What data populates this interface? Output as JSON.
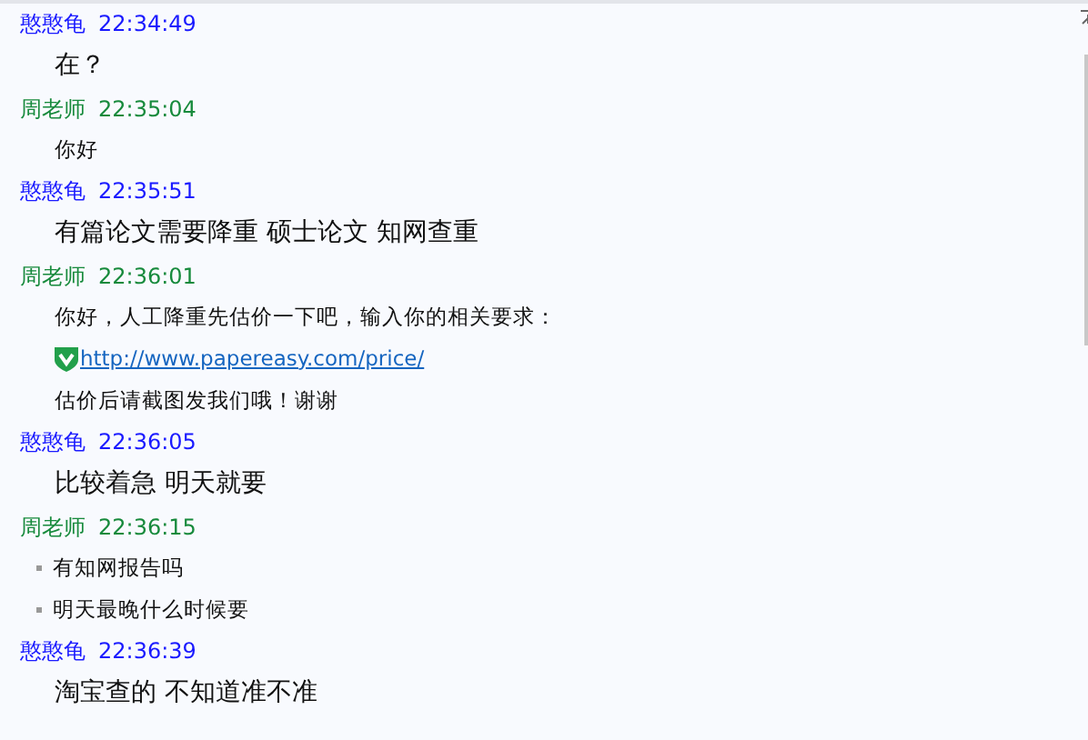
{
  "messages": [
    {
      "sender": "憨憨龟",
      "outgoing": true,
      "time": "22:34:49",
      "lines": [
        {
          "kind": "text",
          "text": "在？"
        }
      ]
    },
    {
      "sender": "周老师",
      "outgoing": false,
      "time": "22:35:04",
      "lines": [
        {
          "kind": "text",
          "text": "你好"
        }
      ]
    },
    {
      "sender": "憨憨龟",
      "outgoing": true,
      "time": "22:35:51",
      "lines": [
        {
          "kind": "text",
          "text": "有篇论文需要降重 硕士论文 知网查重"
        }
      ]
    },
    {
      "sender": "周老师",
      "outgoing": false,
      "time": "22:36:01",
      "lines": [
        {
          "kind": "text",
          "text": "你好，人工降重先估价一下吧，输入你的相关要求："
        },
        {
          "kind": "link",
          "text": "http://www.papereasy.com/price/"
        },
        {
          "kind": "text",
          "text": "估价后请截图发我们哦！谢谢"
        }
      ]
    },
    {
      "sender": "憨憨龟",
      "outgoing": true,
      "time": "22:36:05",
      "lines": [
        {
          "kind": "text",
          "text": "比较着急 明天就要"
        }
      ]
    },
    {
      "sender": "周老师",
      "outgoing": false,
      "time": "22:36:15",
      "lines": [
        {
          "kind": "bullet",
          "text": "有知网报告吗"
        },
        {
          "kind": "bullet",
          "text": "明天最晚什么时候要"
        }
      ]
    },
    {
      "sender": "憨憨龟",
      "outgoing": true,
      "time": "22:36:39",
      "lines": [
        {
          "kind": "text",
          "text": "淘宝查的 不知道准不准"
        }
      ]
    }
  ]
}
